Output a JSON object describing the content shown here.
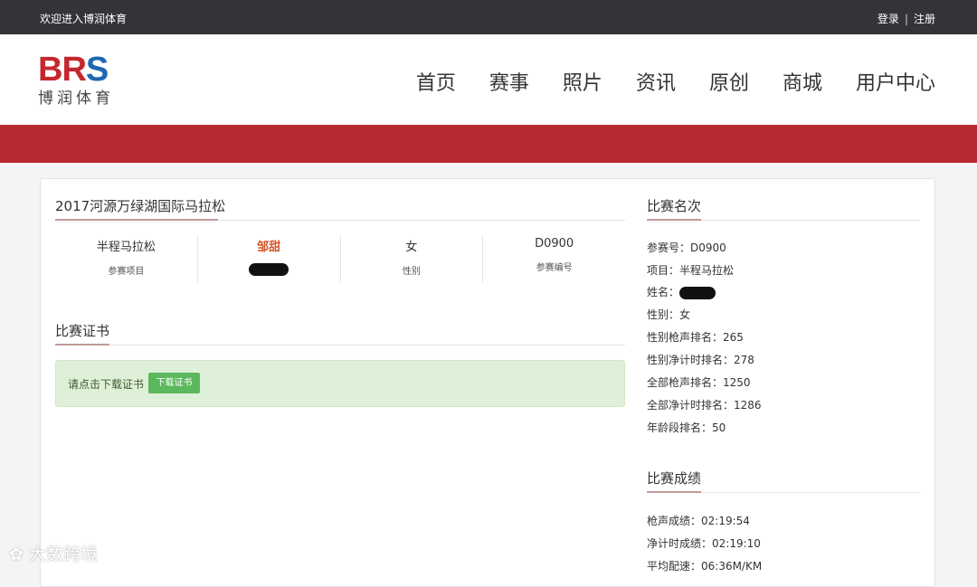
{
  "topbar": {
    "welcome": "欢迎进入博润体育",
    "login": "登录",
    "separator": "|",
    "register": "注册"
  },
  "logo": {
    "brand_br": "BR",
    "brand_s": "S",
    "brand_cn": "博润体育"
  },
  "nav": [
    "首页",
    "赛事",
    "照片",
    "资讯",
    "原创",
    "商城",
    "用户中心"
  ],
  "race": {
    "title": "2017河源万绿湖国际马拉松",
    "stats": [
      {
        "value": "半程马拉松",
        "label": "参赛项目"
      },
      {
        "value": "邹甜",
        "label": ""
      },
      {
        "value": "女",
        "label": "性别"
      },
      {
        "value": "D0900",
        "label": "参赛编号"
      }
    ]
  },
  "certificate": {
    "title": "比赛证书",
    "notice_text": "请点击下载证书",
    "download_button": "下载证书"
  },
  "ranking": {
    "title": "比赛名次",
    "lines": [
      "参赛号：D0900",
      "项目：半程马拉松",
      "姓名：",
      "性别：女",
      "性别枪声排名：265",
      "性别净计时排名：278",
      "全部枪声排名：1250",
      "全部净计时排名：1286",
      "年龄段排名：50"
    ]
  },
  "results": {
    "title": "比赛成绩",
    "lines": [
      "枪声成绩：02:19:54",
      "净计时成绩：02:19:10",
      "平均配速：06:36M/KM"
    ]
  },
  "watermark": "大数跨境",
  "colors": {
    "topbar": "#333438",
    "banner": "#b82a31",
    "name_highlight": "#d4572a",
    "download_btn": "#5cb85c",
    "notice_bg": "#dff0d8"
  }
}
